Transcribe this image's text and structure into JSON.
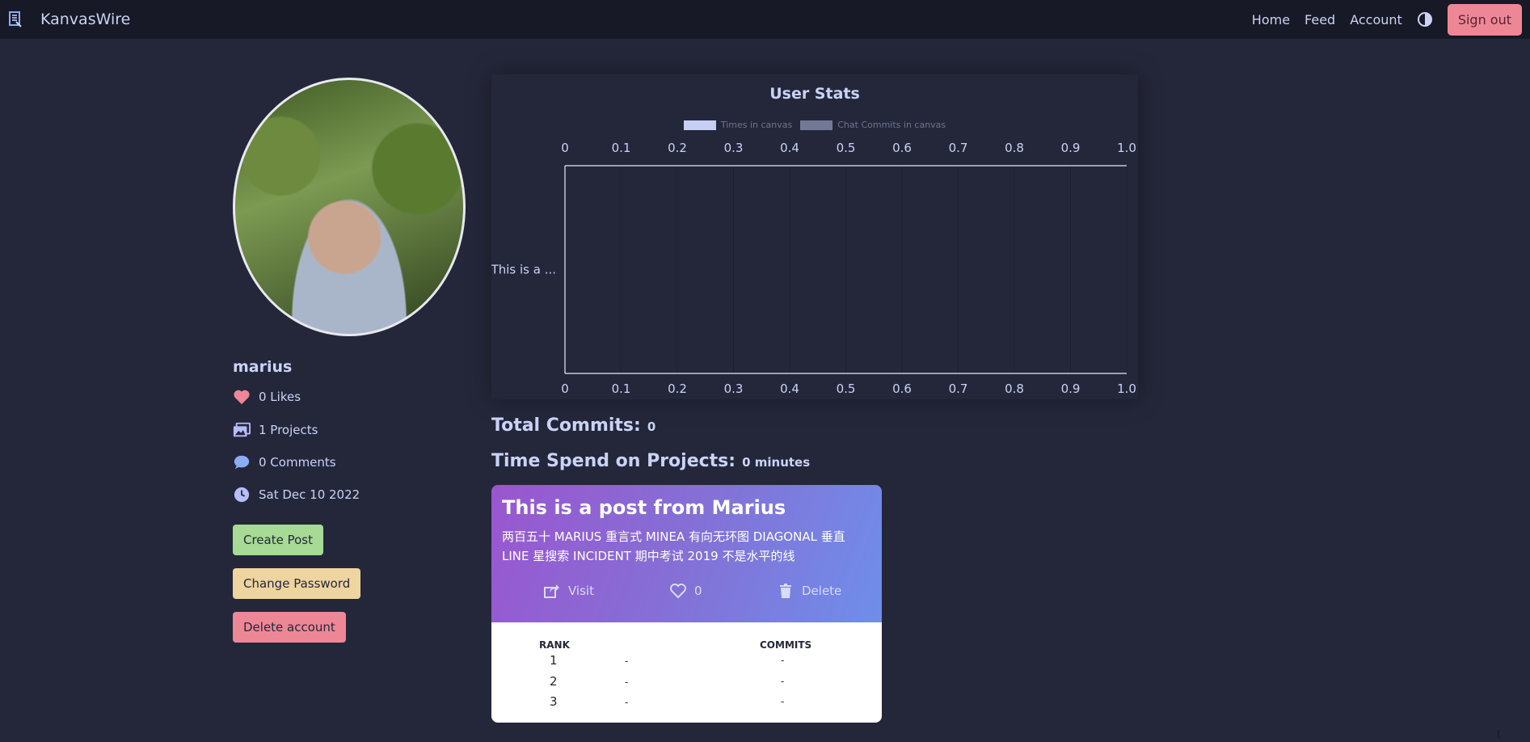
{
  "navbar": {
    "brand": "KanvasWire",
    "links": [
      "Home",
      "Feed",
      "Account"
    ],
    "signout": "Sign out"
  },
  "profile": {
    "username": "marius",
    "stats": {
      "likes": "0 Likes",
      "projects": "1 Projects",
      "comments": "0 Comments",
      "joined": "Sat Dec 10 2022"
    },
    "buttons": {
      "create": "Create Post",
      "change_password": "Change Password",
      "delete": "Delete account"
    }
  },
  "chart_data": {
    "type": "bar",
    "title": "User Stats",
    "orientation": "horizontal",
    "categories": [
      "This is a ..."
    ],
    "series": [
      {
        "name": "Times in canvas",
        "values": [
          0
        ],
        "color": "#c6d0f5"
      },
      {
        "name": "Chat Commits in canvas",
        "values": [
          0
        ],
        "color": "#737994"
      }
    ],
    "xlim": [
      0,
      1.0
    ],
    "x_ticks": [
      "0",
      "0.1",
      "0.2",
      "0.3",
      "0.4",
      "0.5",
      "0.6",
      "0.7",
      "0.8",
      "0.9",
      "1.0"
    ],
    "grid": true,
    "legend": "top"
  },
  "summary": {
    "total_commits_label": "Total Commits:",
    "total_commits_value": "0",
    "time_spend_label": "Time Spend on Projects:",
    "time_spend_value": "0 minutes"
  },
  "post": {
    "title": "This is a post from Marius",
    "description": "两百五十 MARIUS 重言式 MINEA 有向无环图 DIAGONAL 垂直 LINE 星搜索 INCIDENT 期中考试 2019 不是水平的线",
    "actions": {
      "visit": "Visit",
      "likes": "0",
      "delete": "Delete"
    },
    "table": {
      "headers": [
        "RANK",
        "COMMITS"
      ],
      "rows": [
        {
          "rank": "1",
          "name": "-",
          "commits": "-"
        },
        {
          "rank": "2",
          "name": "-",
          "commits": "-"
        },
        {
          "rank": "3",
          "name": "-",
          "commits": "-"
        }
      ]
    }
  },
  "colors": {
    "background": "#24273a",
    "navbar": "#181926",
    "text": "#cad3f5",
    "signout": "#ed8796",
    "create": "#a6da95",
    "change_password": "#eed49f",
    "delete": "#ed8796"
  }
}
